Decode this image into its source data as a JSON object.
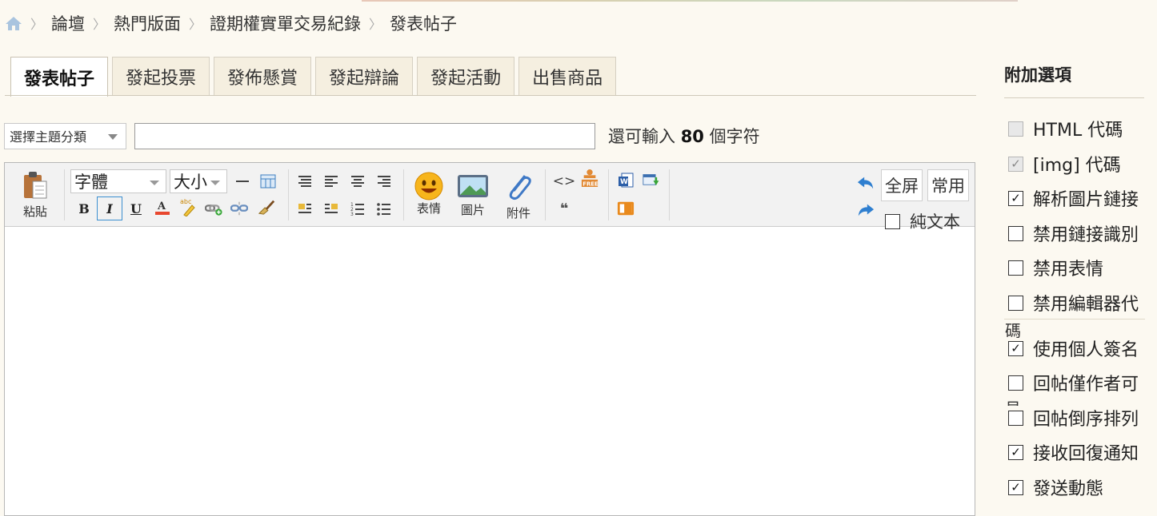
{
  "breadcrumb": {
    "home_icon": "home-icon",
    "items": [
      "論壇",
      "熱門版面",
      "證期權實單交易紀錄",
      "發表帖子"
    ]
  },
  "tabs": [
    "發表帖子",
    "發起投票",
    "發佈懸賞",
    "發起辯論",
    "發起活動",
    "出售商品"
  ],
  "subject": {
    "category_placeholder": "選擇主題分類",
    "remain_prefix": "還可輸入",
    "remain_count": "80",
    "remain_suffix": "個字符"
  },
  "toolbar": {
    "paste_label": "粘貼",
    "font_family": "字體",
    "font_size": "大小",
    "emoticon_label": "表情",
    "image_label": "圖片",
    "attachment_label": "附件",
    "fullscreen_label": "全屏",
    "common_label": "常用",
    "plain_text_label": "純文本",
    "quote_glyph": "❝"
  },
  "sidebar": {
    "title": "附加選項",
    "options": [
      {
        "label": "HTML 代碼",
        "checked": false,
        "disabled": true
      },
      {
        "label": "[img] 代碼",
        "checked": true,
        "disabled": true
      },
      {
        "label": "解析圖片鏈接",
        "checked": true,
        "disabled": false
      },
      {
        "label": "禁用鏈接識別",
        "checked": false,
        "disabled": false
      },
      {
        "label": "禁用表情",
        "checked": false,
        "disabled": false
      },
      {
        "label": "禁用編輯器代",
        "checked": false,
        "disabled": false
      },
      {
        "label": "使用個人簽名",
        "checked": true,
        "disabled": false
      },
      {
        "label": "回帖僅作者可",
        "checked": false,
        "disabled": false
      },
      {
        "label": "回帖倒序排列",
        "checked": false,
        "disabled": false
      },
      {
        "label": "接收回復通知",
        "checked": true,
        "disabled": false
      },
      {
        "label": "發送動態",
        "checked": true,
        "disabled": false
      }
    ],
    "wrap_1": "碼",
    "wrap_2": "見"
  }
}
